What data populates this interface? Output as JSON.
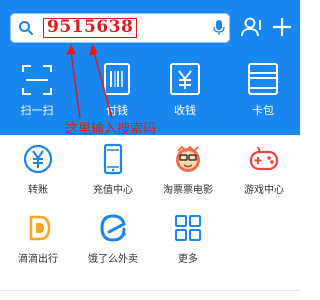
{
  "search": {
    "value": "9515638"
  },
  "quick_actions": [
    {
      "label": "扫一扫",
      "icon": "scan-icon"
    },
    {
      "label": "付钱",
      "icon": "barcode-pay-icon"
    },
    {
      "label": "收钱",
      "icon": "yuan-receive-icon"
    },
    {
      "label": "卡包",
      "icon": "card-wallet-icon"
    }
  ],
  "annotation": "这里输入搜索码",
  "services": [
    {
      "label": "转账",
      "icon": "transfer-icon"
    },
    {
      "label": "充值中心",
      "icon": "recharge-icon"
    },
    {
      "label": "淘票票电影",
      "icon": "movie-ticket-icon"
    },
    {
      "label": "游戏中心",
      "icon": "gamepad-icon"
    },
    {
      "label": "滴滴出行",
      "icon": "didi-icon"
    },
    {
      "label": "饿了么外卖",
      "icon": "eleme-icon"
    },
    {
      "label": "更多",
      "icon": "more-grid-icon"
    }
  ],
  "colors": {
    "header": "#1a86f0",
    "annotation": "#d62020",
    "icon_blue": "#1a86f0"
  }
}
